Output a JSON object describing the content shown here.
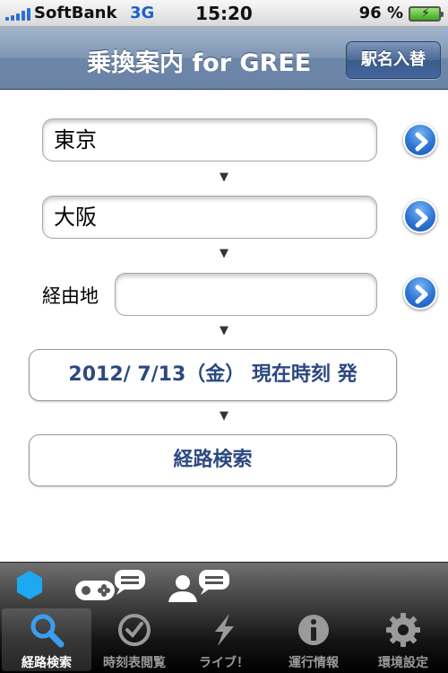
{
  "status_bar": {
    "carrier": "SoftBank",
    "network": "3G",
    "time": "15:20",
    "battery": "96 %"
  },
  "nav_bar": {
    "title": "乗換案内 for GREE",
    "swap_button": "駅名入替"
  },
  "form": {
    "from_value": "東京",
    "to_value": "大阪",
    "via_label": "経由地",
    "via_value": "",
    "arrow": "▼",
    "datetime_button": "2012/ 7/13（金） 現在時刻 発",
    "search_button": "経路検索"
  },
  "tab_bar": {
    "items": [
      {
        "label": "経路検索",
        "icon": "magnifier-icon",
        "selected": true
      },
      {
        "label": "時刻表閲覧",
        "icon": "clock-icon",
        "selected": false
      },
      {
        "label": "ライブ！",
        "icon": "lightning-icon",
        "selected": false
      },
      {
        "label": "運行情報",
        "icon": "info-icon",
        "selected": false
      },
      {
        "label": "環境設定",
        "icon": "gear-icon",
        "selected": false
      }
    ]
  },
  "colors": {
    "accent": "#2c4980",
    "nav": "#7e95b4",
    "link_blue": "#2d74d5",
    "gree_hex": "#1ea8f0"
  }
}
